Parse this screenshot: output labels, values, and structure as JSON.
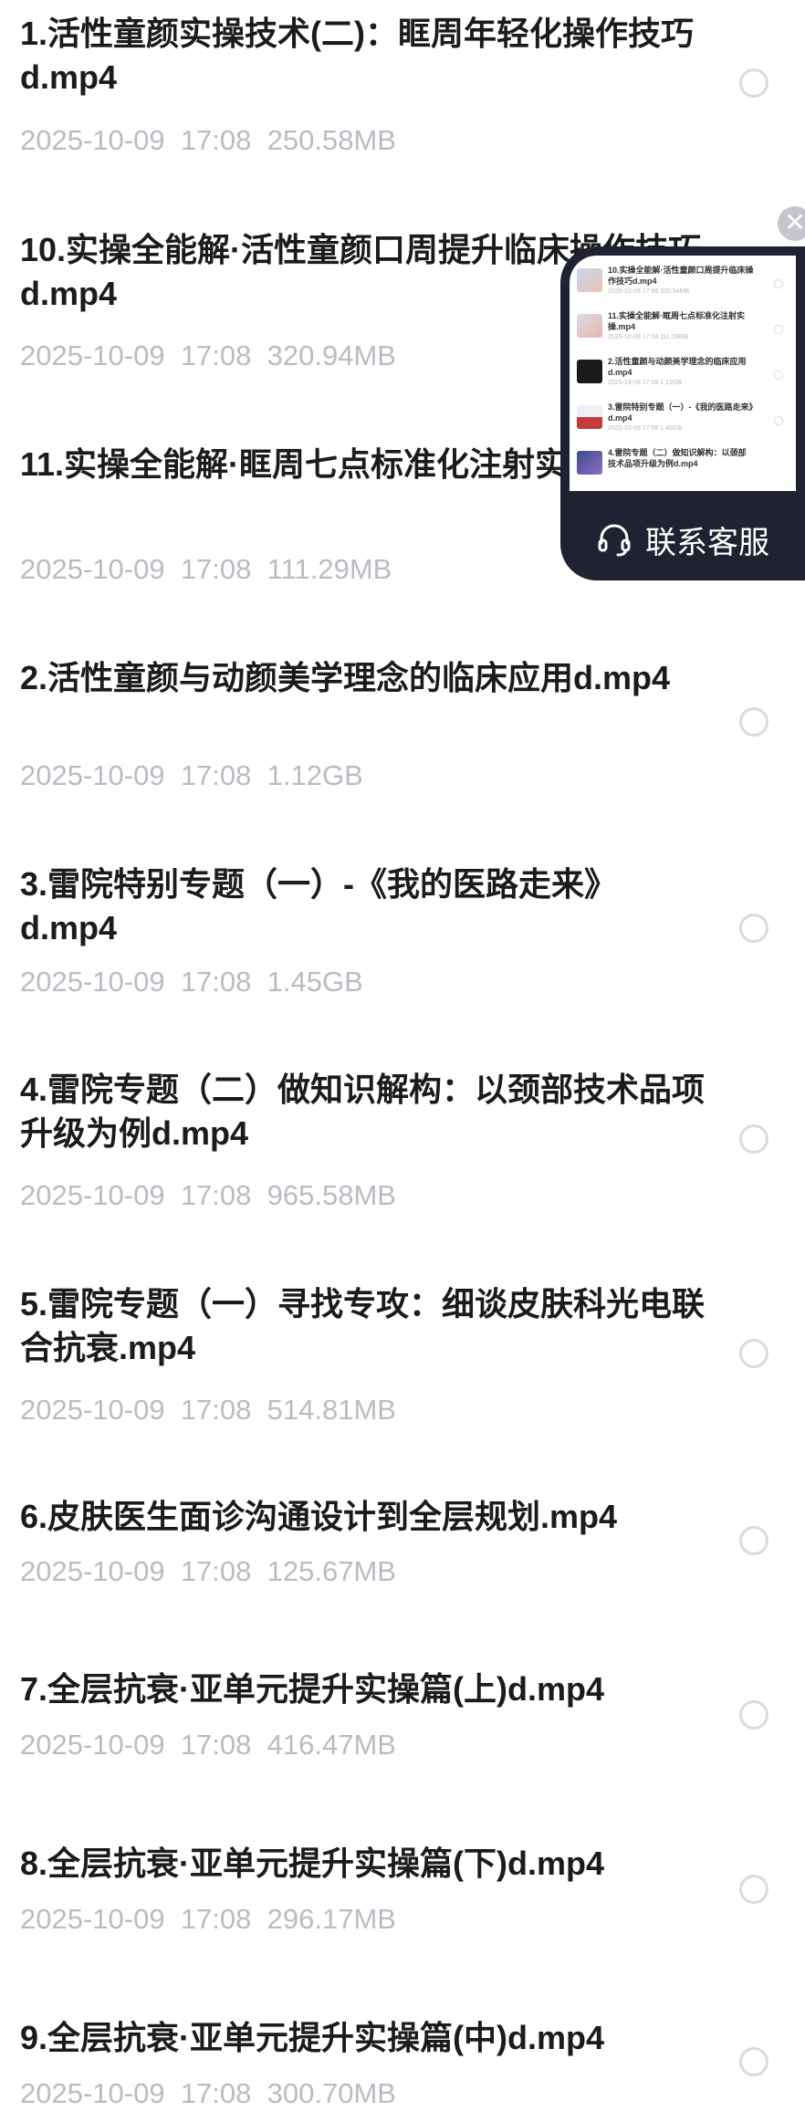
{
  "files": [
    {
      "title": "1.活性童颜实操技术(二)：眶周年轻化操作技巧d.mp4",
      "date": "2025-10-09",
      "time": "17:08",
      "size": "250.58MB"
    },
    {
      "title": "10.实操全能解·活性童颜口周提升临床操作技巧d.mp4",
      "date": "2025-10-09",
      "time": "17:08",
      "size": "320.94MB"
    },
    {
      "title": "11.实操全能解·眶周七点标准化注射实操.mp4",
      "date": "2025-10-09",
      "time": "17:08",
      "size": "111.29MB"
    },
    {
      "title": "2.活性童颜与动颜美学理念的临床应用d.mp4",
      "date": "2025-10-09",
      "time": "17:08",
      "size": "1.12GB"
    },
    {
      "title": "3.雷院特别专题（一）-《我的医路走来》d.mp4",
      "date": "2025-10-09",
      "time": "17:08",
      "size": "1.45GB"
    },
    {
      "title": "4.雷院专题（二）做知识解构：以颈部技术品项升级为例d.mp4",
      "date": "2025-10-09",
      "time": "17:08",
      "size": "965.58MB"
    },
    {
      "title": "5.雷院专题（一）寻找专攻：细谈皮肤科光电联合抗衰.mp4",
      "date": "2025-10-09",
      "time": "17:08",
      "size": "514.81MB"
    },
    {
      "title": "6.皮肤医生面诊沟通设计到全层规划.mp4",
      "date": "2025-10-09",
      "time": "17:08",
      "size": "125.67MB"
    },
    {
      "title": "7.全层抗衰·亚单元提升实操篇(上)d.mp4",
      "date": "2025-10-09",
      "time": "17:08",
      "size": "416.47MB"
    },
    {
      "title": "8.全层抗衰·亚单元提升实操篇(下)d.mp4",
      "date": "2025-10-09",
      "time": "17:08",
      "size": "296.17MB"
    },
    {
      "title": "9.全层抗衰·亚单元提升实操篇(中)d.mp4",
      "date": "2025-10-09",
      "time": "17:08",
      "size": "300.70MB"
    }
  ],
  "popup": {
    "close_symbol": "✕",
    "service_label": "联系客服",
    "headset_icon": "headset-icon",
    "mini_items": [
      {
        "title": "10.实操全能解·活性童颜口周提升临床操作技巧d.mp4",
        "date": "2025-10-09",
        "time": "17:08",
        "size": "320.94MB"
      },
      {
        "title": "11.实操全能解·眶周七点标准化注射实操.mp4",
        "date": "2025-10-09",
        "time": "17:08",
        "size": "111.29MB"
      },
      {
        "title": "2.活性童颜与动颜美学理念的临床应用d.mp4",
        "date": "2025-10-09",
        "time": "17:08",
        "size": "1.12GB"
      },
      {
        "title": "3.雷院特别专题（一）-《我的医路走来》d.mp4",
        "date": "2025-10-09",
        "time": "17:08",
        "size": "1.45GB"
      },
      {
        "title": "4.雷院专题（二）做知识解构：以颈部技术品项升级为例d.mp4",
        "date": "",
        "time": "",
        "size": ""
      }
    ]
  },
  "colors": {
    "title": "#1b1b1b",
    "meta": "#b9bcc3",
    "radio_border": "#d9dbe0",
    "popup_bg": "#1f2230"
  }
}
